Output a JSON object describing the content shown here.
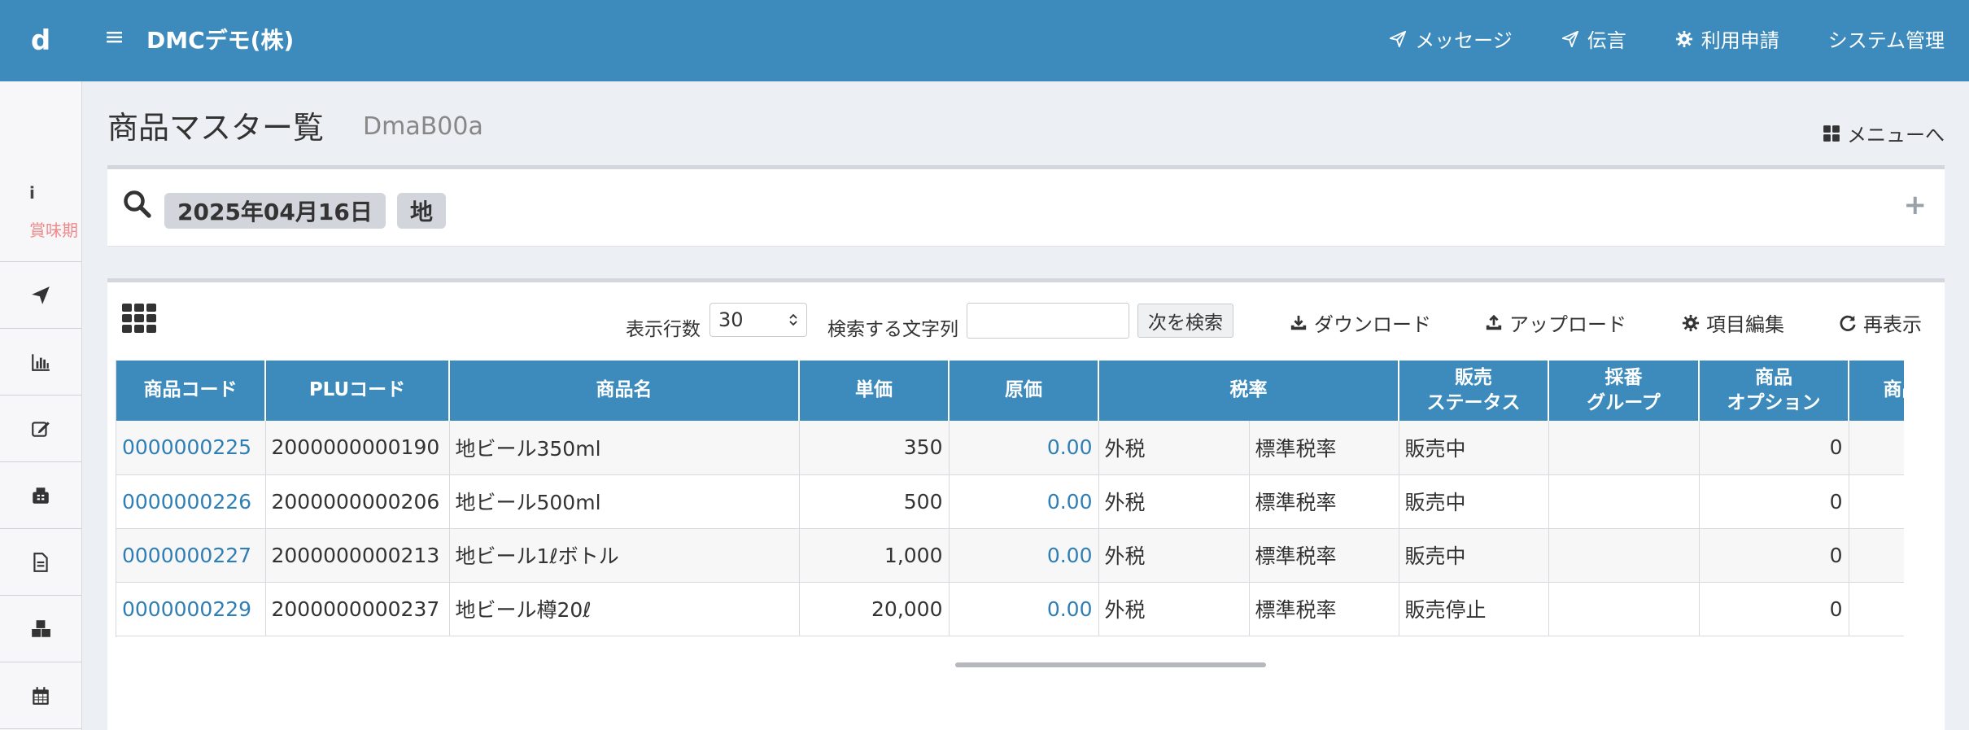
{
  "header": {
    "logo": "d",
    "menu_icon": "≡",
    "company": "DMCデモ(株)",
    "nav": [
      {
        "label": "メッセージ",
        "icon": "paper-plane"
      },
      {
        "label": "伝言",
        "icon": "paper-plane"
      },
      {
        "label": "利用申請",
        "icon": "gear"
      },
      {
        "label": "システム管理",
        "icon": ""
      }
    ]
  },
  "sidebar": {
    "info_icon": "i",
    "info_note": "賞味期",
    "items": [
      {
        "icon": "paper-plane-icon"
      },
      {
        "icon": "bar-chart-icon"
      },
      {
        "icon": "edit-icon"
      },
      {
        "icon": "fax-icon"
      },
      {
        "icon": "document-icon"
      },
      {
        "icon": "cubes-icon"
      },
      {
        "icon": "calendar-icon"
      }
    ]
  },
  "page": {
    "title": "商品マスター覧",
    "code": "DmaB00a",
    "menu_link": "メニューへ"
  },
  "search": {
    "chips": [
      "2025年04月16日",
      "地"
    ],
    "expand": "+"
  },
  "toolbar": {
    "rows_label": "表示行数",
    "rows_value": "30",
    "search_label": "検索する文字列",
    "search_value": "",
    "next_button": "次を検索",
    "download": "ダウンロード",
    "upload": "アップロード",
    "edit_columns": "項目編集",
    "refresh": "再表示"
  },
  "table": {
    "headers": {
      "code": "商品コード",
      "plu": "PLUコード",
      "name": "商品名",
      "price": "単価",
      "cost": "原価",
      "tax": "税率",
      "status_l1": "販売",
      "status_l2": "ステータス",
      "group_l1": "採番",
      "group_l2": "グループ",
      "option_l1": "商品",
      "option_l2": "オプション",
      "more": "商品"
    },
    "rows": [
      {
        "code": "0000000225",
        "plu": "2000000000190",
        "name": "地ビール350ml",
        "price": "350",
        "cost": "0.00",
        "tax_type": "外税",
        "tax_rate": "標準税率",
        "status": "販売中",
        "group": "",
        "option": "0",
        "more": ""
      },
      {
        "code": "0000000226",
        "plu": "2000000000206",
        "name": "地ビール500ml",
        "price": "500",
        "cost": "0.00",
        "tax_type": "外税",
        "tax_rate": "標準税率",
        "status": "販売中",
        "group": "",
        "option": "0",
        "more": ""
      },
      {
        "code": "0000000227",
        "plu": "2000000000213",
        "name": "地ビール1ℓボトル",
        "price": "1,000",
        "cost": "0.00",
        "tax_type": "外税",
        "tax_rate": "標準税率",
        "status": "販売中",
        "group": "",
        "option": "0",
        "more": ""
      },
      {
        "code": "0000000229",
        "plu": "2000000000237",
        "name": "地ビール樽20ℓ",
        "price": "20,000",
        "cost": "0.00",
        "tax_type": "外税",
        "tax_rate": "標準税率",
        "status": "販売停止",
        "group": "",
        "option": "0",
        "more": ""
      }
    ]
  },
  "colors": {
    "header_bg": "#3d8bbd",
    "link": "#2f7fb5",
    "chip_bg": "#d2d5db",
    "note_text": "#f08a8a"
  }
}
